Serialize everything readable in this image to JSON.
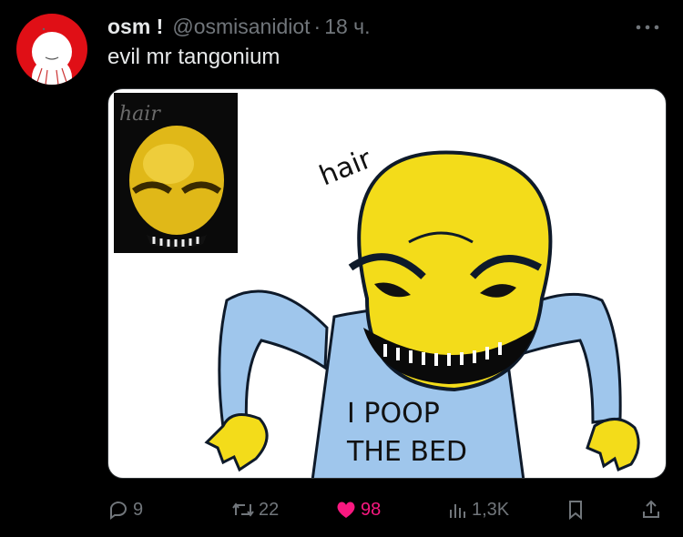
{
  "tweet": {
    "author_name": "osm !",
    "author_handle": "@osmisanidiot",
    "separator": "·",
    "time": "18 ч.",
    "text": "evil mr tangonium"
  },
  "media": {
    "inset_caption": "hair",
    "main_caption": "hair",
    "shirt_text_line1": "I POOP",
    "shirt_text_line2": "THE BED"
  },
  "actions": {
    "replies": "9",
    "retweets": "22",
    "likes": "98",
    "views": "1,3K"
  },
  "colors": {
    "like_pink": "#f91880",
    "muted": "#71767b",
    "avatar_red": "#e00f16",
    "face_yellow": "#f3dc1a",
    "shirt_blue": "#9fc6ec"
  },
  "icons": [
    "reply-icon",
    "retweet-icon",
    "like-icon",
    "views-icon",
    "bookmark-icon",
    "share-icon",
    "more-icon"
  ]
}
